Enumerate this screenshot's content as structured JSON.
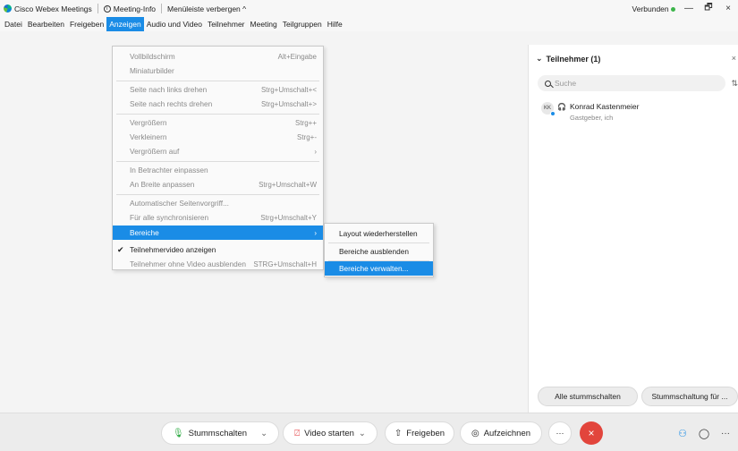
{
  "titlebar": {
    "app_name": "Cisco Webex Meetings",
    "meeting_info": "Meeting-Info",
    "hide_menu": "Menüleiste verbergen ^",
    "status": "Verbunden",
    "minimize": "—",
    "restore": "🗗",
    "close": "×"
  },
  "menubar": [
    "Datei",
    "Bearbeiten",
    "Freigeben",
    "Anzeigen",
    "Audio und Video",
    "Teilnehmer",
    "Meeting",
    "Teilgruppen",
    "Hilfe"
  ],
  "dropdown": {
    "items": [
      {
        "label": "Vollbildschirm",
        "shortcut": "Alt+Eingabe"
      },
      {
        "label": "Miniaturbilder",
        "shortcut": ""
      },
      {
        "label": "Seite nach links drehen",
        "shortcut": "Strg+Umschalt+<"
      },
      {
        "label": "Seite nach rechts drehen",
        "shortcut": "Strg+Umschalt+>"
      },
      {
        "label": "Vergrößern",
        "shortcut": "Strg++"
      },
      {
        "label": "Verkleinern",
        "shortcut": "Strg+-"
      },
      {
        "label": "Vergrößern auf",
        "shortcut": "›"
      },
      {
        "label": "In Betrachter einpassen",
        "shortcut": ""
      },
      {
        "label": "An Breite anpassen",
        "shortcut": "Strg+Umschalt+W"
      },
      {
        "label": "Automatischer Seitenvorgriff...",
        "shortcut": ""
      },
      {
        "label": "Für alle synchronisieren",
        "shortcut": "Strg+Umschalt+Y"
      },
      {
        "label": "Bereiche",
        "shortcut": "›"
      },
      {
        "label": "Teilnehmervideo anzeigen",
        "shortcut": ""
      },
      {
        "label": "Teilnehmer ohne Video ausblenden",
        "shortcut": "STRG+Umschalt+H"
      }
    ]
  },
  "submenu": {
    "items": [
      "Layout wiederherstellen",
      "Bereiche ausblenden",
      "Bereiche verwalten..."
    ]
  },
  "panel": {
    "title": "Teilnehmer (1)",
    "search_placeholder": "Suche",
    "participant_initials": "KK",
    "participant_name": "Konrad Kastenmeier",
    "participant_role": "Gastgeber, ich",
    "mute_all": "Alle stummschalten",
    "mute_for": "Stummschaltung für ..."
  },
  "toolbar": {
    "mute": "Stummschalten",
    "video": "Video starten",
    "share": "Freigeben",
    "record": "Aufzeichnen",
    "more": "···"
  },
  "colors": {
    "accent": "#1a8ce6",
    "end": "#e2453c",
    "connected": "#3cb54a"
  }
}
